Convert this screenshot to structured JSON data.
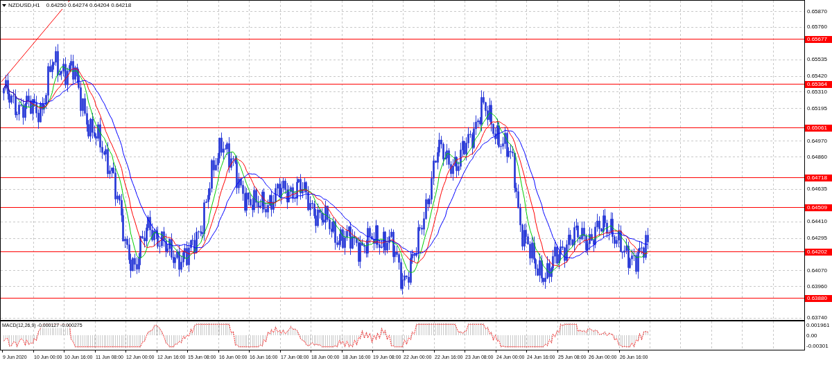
{
  "header": {
    "symbol": "NZDUSD,H1",
    "quotes": "0.64250 0.64274 0.64204 0.64218"
  },
  "price_axis": [
    "0.65870",
    "0.65760",
    "0.65535",
    "0.65420",
    "0.65310",
    "0.65195",
    "0.64970",
    "0.64860",
    "0.64635",
    "0.64410",
    "0.64295",
    "0.64070",
    "0.63960",
    "0.63740"
  ],
  "level_lines": [
    {
      "label": "0.65677"
    },
    {
      "label": "0.65364"
    },
    {
      "label": "0.65061"
    },
    {
      "label": "0.64718"
    },
    {
      "label": "0.64509"
    },
    {
      "label": "0.64202"
    },
    {
      "label": "0.63880"
    }
  ],
  "macd": {
    "title": "MACD(12,26,9) -0.000127 -0.000275",
    "axis": [
      "0.001961",
      "0.00",
      "-0.00301"
    ]
  },
  "time_axis": [
    "9 Jun 2020",
    "10 Jun 00:00",
    "10 Jun 16:00",
    "11 Jun 08:00",
    "12 Jun 00:00",
    "12 Jun 16:00",
    "15 Jun 08:00",
    "16 Jun 00:00",
    "16 Jun 16:00",
    "17 Jun 08:00",
    "18 Jun 00:00",
    "18 Jun 16:00",
    "19 Jun 08:00",
    "22 Jun 00:00",
    "22 Jun 16:00",
    "23 Jun 08:00",
    "24 Jun 00:00",
    "24 Jun 16:00",
    "25 Jun 08:00",
    "26 Jun 00:00",
    "26 Jun 16:00"
  ]
}
